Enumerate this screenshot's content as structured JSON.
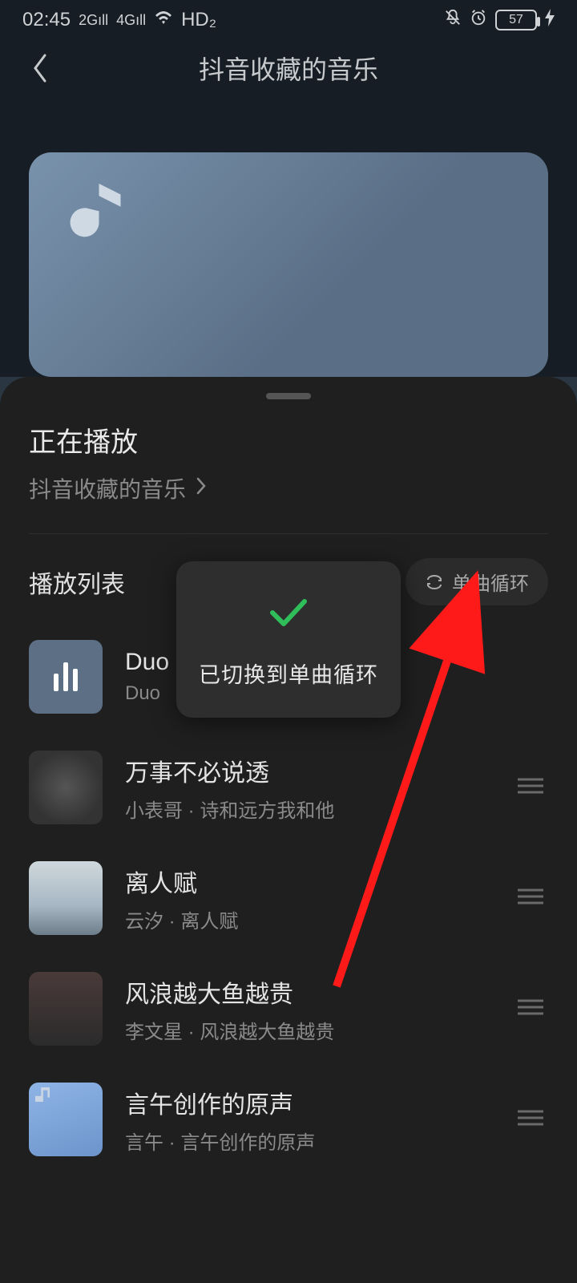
{
  "status": {
    "time": "02:45",
    "net1": "2G",
    "net2": "4G",
    "wifi": "wifi",
    "hd": "HD₂",
    "battery": "57"
  },
  "header": {
    "title": "抖音收藏的音乐"
  },
  "sheet": {
    "now_playing_title": "正在播放",
    "now_playing_source": "抖音收藏的音乐",
    "playlist_title": "播放列表",
    "loop_mode_label": "单曲循环"
  },
  "toast": {
    "message": "已切换到单曲循环"
  },
  "songs": [
    {
      "title": "Duo",
      "subtitle": "Duo",
      "playing": true,
      "cover": "playing"
    },
    {
      "title": "万事不必说透",
      "subtitle": "小表哥 · 诗和远方我和他",
      "cover": "bw"
    },
    {
      "title": "离人赋",
      "subtitle": "云汐 · 离人赋",
      "cover": "lake"
    },
    {
      "title": "风浪越大鱼越贵",
      "subtitle": "李文星 · 风浪越大鱼越贵",
      "cover": "street"
    },
    {
      "title": "言午创作的原声",
      "subtitle": "言午 · 言午创作的原声",
      "cover": "blue"
    }
  ]
}
